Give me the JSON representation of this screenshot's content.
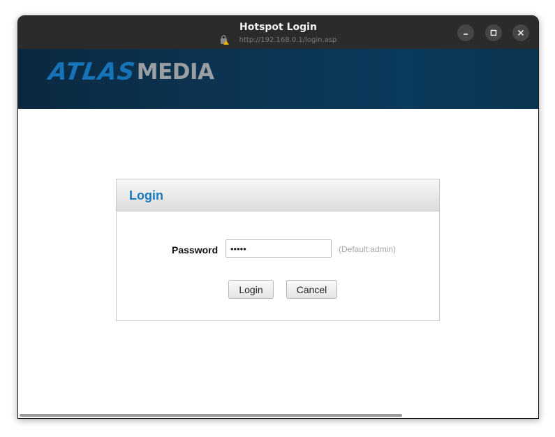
{
  "window": {
    "title": "Hotspot Login",
    "url": "http://192.168.0.1/login.asp",
    "controls": [
      "minimize-icon",
      "maximize-icon",
      "close-icon"
    ]
  },
  "banner": {
    "logo_part1": "ATLAS",
    "logo_part2": "MEDIA"
  },
  "login": {
    "heading": "Login",
    "password_label": "Password",
    "password_value": "•••••",
    "password_hint": "(Default:admin)",
    "login_button": "Login",
    "cancel_button": "Cancel"
  },
  "colors": {
    "titlebar": "#2b2b2b",
    "banner": "#0c3452",
    "accent": "#1a78be",
    "logo_atlas": "#1673b8",
    "logo_media": "#9a9fa4"
  }
}
